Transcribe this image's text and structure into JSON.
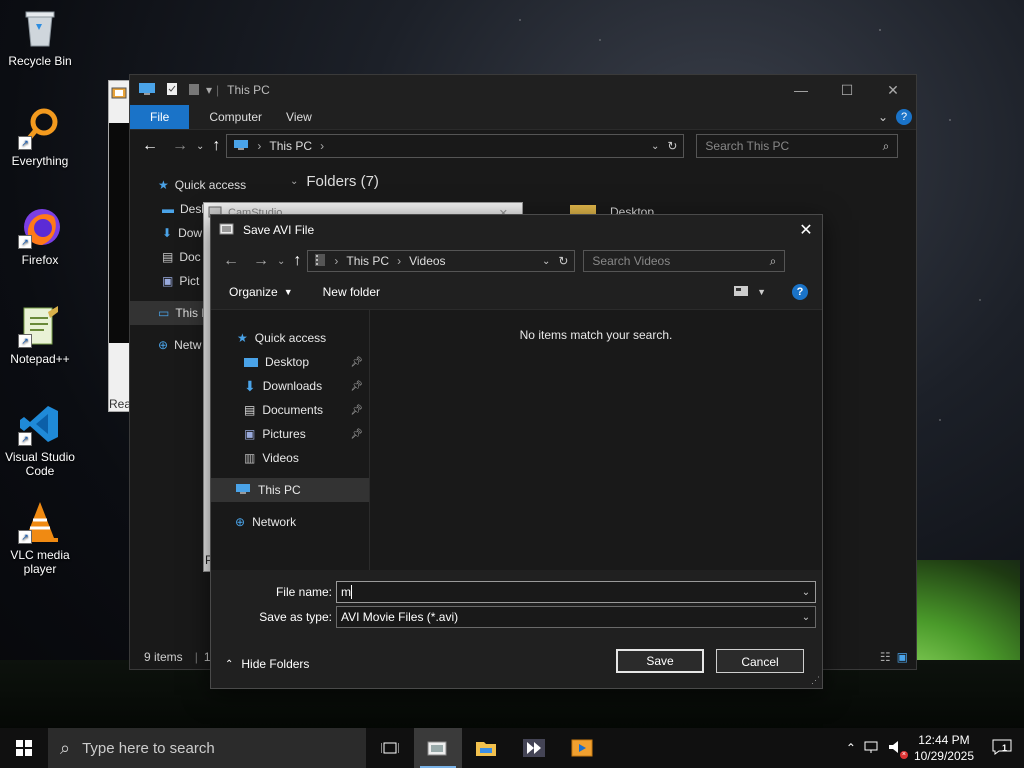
{
  "desktop": {
    "icons": [
      {
        "label": "Recycle Bin"
      },
      {
        "label": "Everything"
      },
      {
        "label": "Firefox"
      },
      {
        "label": "Notepad++"
      },
      {
        "label": "Visual Studio Code"
      },
      {
        "label": "VLC media player"
      }
    ]
  },
  "explorer": {
    "title": "This PC",
    "ribbon_tabs": [
      "File",
      "Computer",
      "View"
    ],
    "address_location": "This PC",
    "search_placeholder": "Search This PC",
    "section_header": "Folders (7)",
    "folder_peek": "Desktop",
    "nav": {
      "quick_access": "Quick access",
      "items": [
        "Desk",
        "Dow",
        "Doc",
        "Pict"
      ],
      "this_pc": "This P",
      "network": "Netw"
    },
    "status_items": "9 items",
    "status_extra": "1"
  },
  "ghost_window": {
    "partial_label": "Rea"
  },
  "camstudio": {
    "title": "CamStudio",
    "partial_bottom": "P"
  },
  "dialog": {
    "title": "Save AVI File",
    "breadcrumb": [
      "This PC",
      "Videos"
    ],
    "search_placeholder": "Search Videos",
    "organize_label": "Organize",
    "new_folder_label": "New folder",
    "empty_message": "No items match your search.",
    "nav": {
      "quick_access": "Quick access",
      "pinned": [
        "Desktop",
        "Downloads",
        "Documents",
        "Pictures"
      ],
      "videos": "Videos",
      "this_pc": "This PC",
      "network": "Network"
    },
    "file_name_label": "File name:",
    "file_name_value": "m",
    "save_type_label": "Save as type:",
    "save_type_value": "AVI Movie Files (*.avi)",
    "hide_folders_label": "Hide Folders",
    "save_label": "Save",
    "cancel_label": "Cancel"
  },
  "taskbar": {
    "search_placeholder": "Type here to search",
    "time": "12:44 PM",
    "date": "10/29/2025",
    "notification_count": "1"
  }
}
